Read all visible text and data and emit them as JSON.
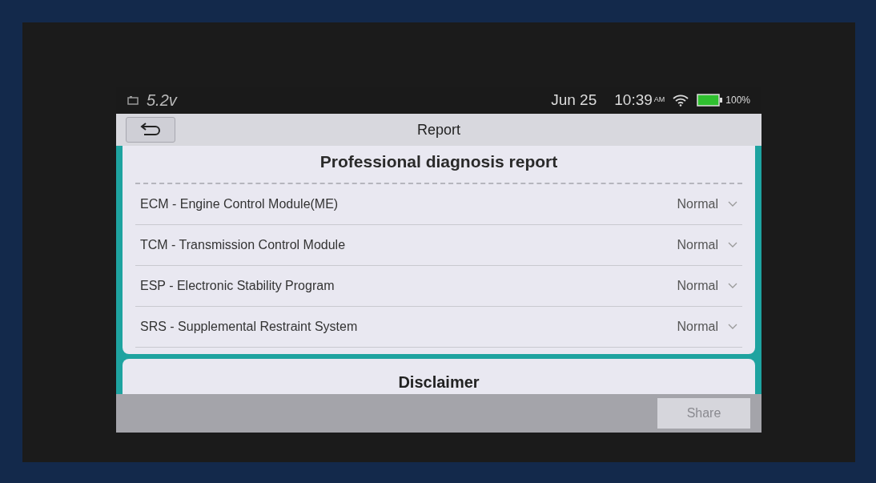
{
  "status_bar": {
    "voltage": "5.2v",
    "date": "Jun 25",
    "time": "10:39",
    "meridiem": "AM",
    "battery": "100%"
  },
  "header": {
    "title": "Report"
  },
  "report": {
    "title": "Professional diagnosis report",
    "modules": [
      {
        "name": "ECM - Engine Control Module(ME)",
        "status": "Normal"
      },
      {
        "name": "TCM - Transmission Control Module",
        "status": "Normal"
      },
      {
        "name": "ESP - Electronic Stability Program",
        "status": "Normal"
      },
      {
        "name": "SRS - Supplemental Restraint System",
        "status": "Normal"
      }
    ]
  },
  "disclaimer": {
    "title": "Disclaimer"
  },
  "footer": {
    "button": "Share"
  }
}
